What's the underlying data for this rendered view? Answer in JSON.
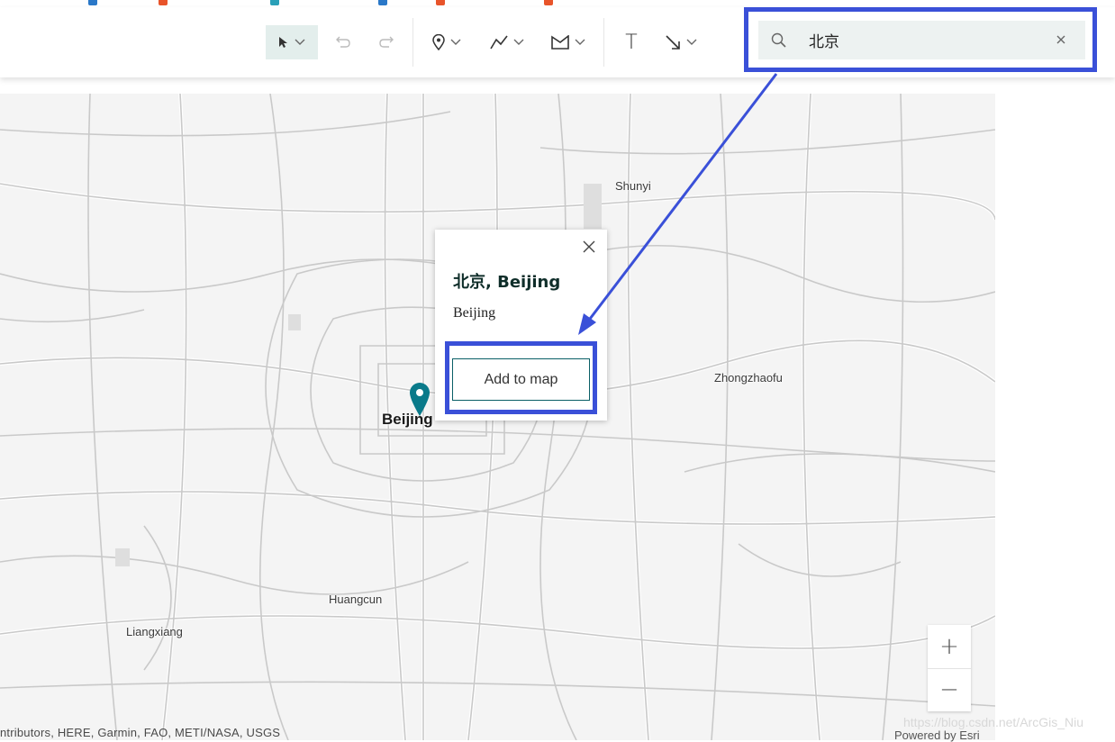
{
  "toolbar": {
    "select_tool": "select-arrow",
    "undo": "undo",
    "redo": "redo",
    "point_tool": "pin",
    "polyline_tool": "polyline",
    "polygon_tool": "polygon",
    "text_tool_label": "T",
    "arrow_tool": "arrow"
  },
  "search": {
    "value": "北京",
    "clear_label": "×"
  },
  "map": {
    "places": {
      "shunyi": "Shunyi",
      "zhongzhaofu": "Zhongzhaofu",
      "beijing": "Beijing",
      "huangcun": "Huangcun",
      "liangxiang": "Liangxiang"
    },
    "attribution": "ntributors, HERE, Garmin, FAO, METI/NASA, USGS",
    "powered_by": "Powered by Esri",
    "watermark": "https://blog.csdn.net/ArcGis_Niu"
  },
  "popup": {
    "title": "北京, Beijing",
    "subtitle": "Beijing",
    "add_button": "Add to map"
  },
  "zoom": {
    "in_label": "+",
    "out_label": "−"
  },
  "colors": {
    "highlight": "#3a50d8",
    "accent": "#0a7a8a",
    "toolbar_active": "#e3eeec"
  }
}
